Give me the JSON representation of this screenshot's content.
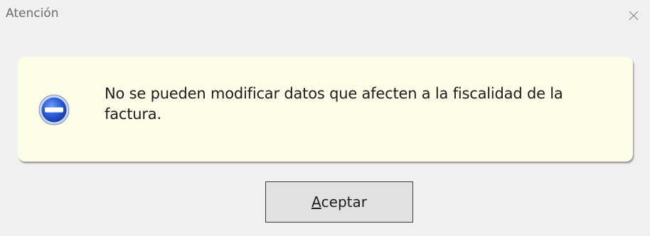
{
  "window": {
    "title": "Atención",
    "close_icon": "close-icon"
  },
  "message": {
    "icon": "stop-error-icon",
    "text": "No se pueden modificar datos que afecten a la fiscalidad de la factura."
  },
  "buttons": {
    "ok_mnemonic": "A",
    "ok_rest": "ceptar"
  },
  "colors": {
    "panel_background": "#fdfde8",
    "icon_blue": "#2a5bd7",
    "dialog_background": "#f0f0f0"
  }
}
